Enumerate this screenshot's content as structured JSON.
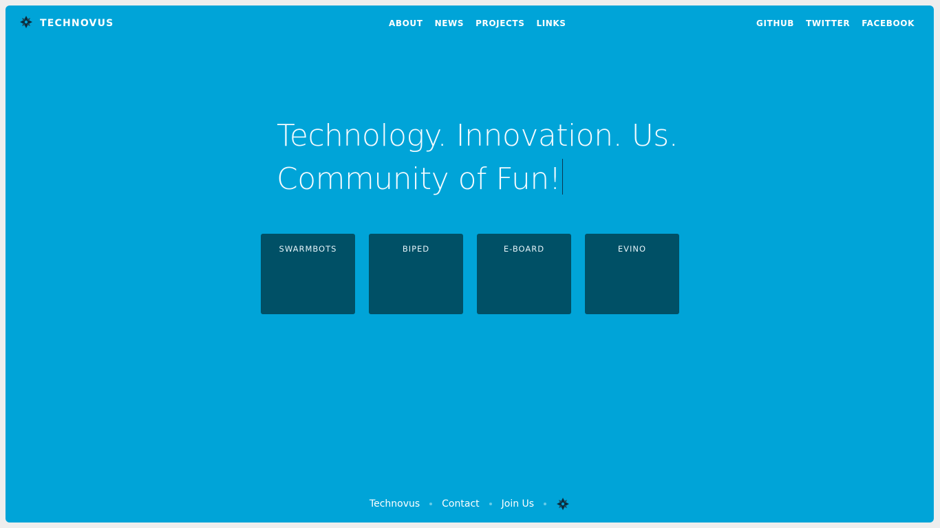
{
  "header": {
    "brand": "TECHNOVUS",
    "nav_center": [
      "ABOUT",
      "NEWS",
      "PROJECTS",
      "LINKS"
    ],
    "nav_right": [
      "GITHUB",
      "TWITTER",
      "FACEBOOK"
    ]
  },
  "hero": {
    "line1": "Technology. Innovation. Us.",
    "line2": "Community of Fun!"
  },
  "projects": [
    "SWARMBOTS",
    "BIPED",
    "E-BOARD",
    "EVINO"
  ],
  "footer": {
    "links": [
      "Technovus",
      "Contact",
      "Join Us"
    ],
    "logo_icon": "technovus-logo-icon"
  },
  "colors": {
    "background": "#00a4d8",
    "card": "#005066",
    "text": "#ffffff"
  }
}
